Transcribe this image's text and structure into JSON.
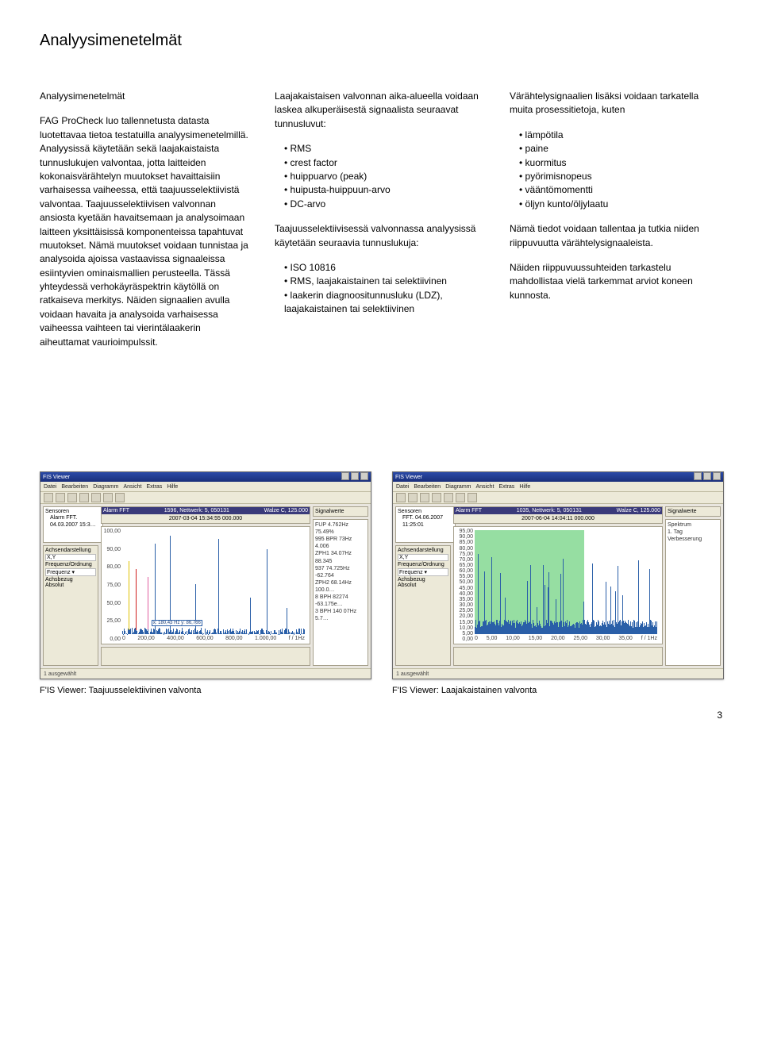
{
  "page": {
    "title": "Analyysimenetelmät",
    "number": "3"
  },
  "col1": {
    "subheading": "Analyysimenetelmät",
    "p1": "FAG ProCheck luo tallennetusta datasta luotettavaa tietoa testatuilla analyysimenetelmillä. Analyysissä käytetään sekä laajakaistaista tunnuslukujen valvontaa, jotta laitteiden kokonaisvärähtelyn muutokset havaittaisiin varhaisessa vaiheessa, että taajuusselektiivistä valvontaa. Taajuusselektiivisen valvonnan ansiosta kyetään havaitsemaan ja analysoimaan laitteen yksittäisissä komponenteissa tapahtuvat muutokset. Nämä muutokset voidaan tunnistaa ja analysoida ajoissa vastaavissa signaaleissa esiintyvien ominaismallien perusteella. Tässä yhteydessä verhokäyräspektrin käytöllä on ratkaiseva merkitys. Näiden signaalien avulla voidaan havaita ja analysoida varhaisessa vaiheessa vaihteen tai vierintälaakerin aiheuttamat vaurioimpulssit."
  },
  "col2": {
    "p1": "Laajakaistaisen valvonnan aika-alueella voidaan laskea alkuperäisestä signaalista seuraavat tunnusluvut:",
    "list1": [
      "RMS",
      "crest factor",
      "huippuarvo (peak)",
      "huipusta-huippuun-arvo",
      "DC-arvo"
    ],
    "p2": "Taajuusselektiivisessä valvonnassa analyysissä käytetään seuraavia tunnuslukuja:",
    "list2": [
      "ISO 10816",
      "RMS, laajakaistainen tai selektiivinen",
      "laakerin diagnoositunnusluku (LDZ), laajakaistainen tai selektiivinen"
    ]
  },
  "col3": {
    "p1": "Värähtelysignaalien lisäksi voidaan tarkatella muita prosessitietoja, kuten",
    "list1": [
      "lämpötila",
      "paine",
      "kuormitus",
      "pyörimisnopeus",
      "vääntömomentti",
      "öljyn kunto/öljylaatu"
    ],
    "p2": "Nämä tiedot voidaan tallentaa ja tutkia niiden riippuvuutta värähtelysignaaleista.",
    "p3": "Näiden riippuvuussuhteiden tarkastelu mahdollistaa vielä tarkemmat arviot koneen kunnosta."
  },
  "figures": {
    "left_caption_prefix": "F'IS Viewer: ",
    "left_caption": "Taajuusselektiivinen valvonta",
    "right_caption_prefix": "F'IS Viewer: ",
    "right_caption": "Laajakaistainen valvonta"
  },
  "app": {
    "title": "FIS Viewer",
    "menu": [
      "Datei",
      "Bearbeiten",
      "Diagramm",
      "Ansicht",
      "Extras",
      "Hilfe"
    ],
    "tree_root": "Sensoren",
    "tree_item_left": "Alarm FFT. 04.03.2007 15:3…",
    "tree_item_right": "FFT. 04.06.2007 11:25:01",
    "side_labels": {
      "l1": "Achsendarstellung",
      "l2": "Frequenz/Ordnung",
      "l3": "Achsbezug",
      "l4": "Absolut"
    },
    "panel_left": {
      "title": "Alarm FFT",
      "net": "1596, Nettwerk: 5, 050131 ",
      "set": "Walze C, 125.000"
    },
    "panel_right": {
      "title": "Alarm FFT",
      "net": "1035, Nettwerk: 5, 050131 ",
      "set": "Walze C, 125.000"
    },
    "timestamp_left": "2007-03-04 15:34:55 000.000",
    "timestamp_right": "2007-06-04 14:04:11 000.000",
    "y_ticks": [
      "100,00",
      "90,00",
      "80,00",
      "75,00",
      "50,00",
      "25,00",
      "0,00"
    ],
    "y_ticks_dense": [
      "95,00",
      "90,00",
      "85,00",
      "80,00",
      "75,00",
      "70,00",
      "65,00",
      "60,00",
      "55,00",
      "50,00",
      "45,00",
      "40,00",
      "35,00",
      "30,00",
      "25,00",
      "20,00",
      "15,00",
      "10,00",
      "5,00",
      "0,00"
    ],
    "x_ticks_left": [
      "0",
      "200,00",
      "400,00",
      "600,00",
      "800,00",
      "1.000,00",
      "f / 1Hz"
    ],
    "x_ticks_right": [
      "0",
      "5,00",
      "10,00",
      "15,00",
      "20,00",
      "25,00",
      "30,00",
      "35,00",
      "f / 1Hz"
    ],
    "cursor_left": "x: 180,43 Hz\ny: 86,766",
    "info_left": [
      "FUP  4.762Hz  75.49%",
      "995 BPR 73Hz  4.006",
      "ZPH1 34.07Hz  88.345",
      "937 74.725Hz -62.764",
      "ZPH2 68.14Hz 100.0…",
      "8 BPH 82274  -63.175e…",
      "3 BPH 140 07Hz  5.7…"
    ],
    "info_right": [
      "Spektrum",
      "1. Tag Verbesserung"
    ],
    "sig_label": "Signalwerte",
    "status": "1 ausgewählt"
  },
  "chart_data": [
    {
      "type": "line",
      "title": "Taajuusselektiivinen valvonta (FFT spectrum)",
      "xlabel": "f / 1Hz",
      "ylabel": "",
      "xlim": [
        0,
        1000
      ],
      "ylim": [
        0,
        100
      ],
      "peaks": [
        {
          "x": 34,
          "y": 70,
          "color": "yellow"
        },
        {
          "x": 75,
          "y": 63,
          "color": "red"
        },
        {
          "x": 140,
          "y": 55,
          "color": "pink"
        },
        {
          "x": 180,
          "y": 87,
          "color": "blue"
        },
        {
          "x": 262,
          "y": 95,
          "color": "blue"
        },
        {
          "x": 400,
          "y": 48,
          "color": "blue"
        },
        {
          "x": 525,
          "y": 92,
          "color": "blue"
        },
        {
          "x": 700,
          "y": 35,
          "color": "blue"
        },
        {
          "x": 790,
          "y": 82,
          "color": "blue"
        },
        {
          "x": 900,
          "y": 25,
          "color": "blue"
        }
      ]
    },
    {
      "type": "line",
      "title": "Laajakaistainen valvonta (broadband FFT)",
      "xlabel": "f / 1Hz",
      "ylabel": "",
      "xlim": [
        0,
        35
      ],
      "ylim": [
        0,
        95
      ],
      "bands": [
        {
          "from": 0,
          "to": 8,
          "color": "green"
        },
        {
          "from": 8,
          "to": 14,
          "color": "green"
        },
        {
          "from": 14,
          "to": 21,
          "color": "green"
        }
      ],
      "noise_max_y": 40
    }
  ]
}
